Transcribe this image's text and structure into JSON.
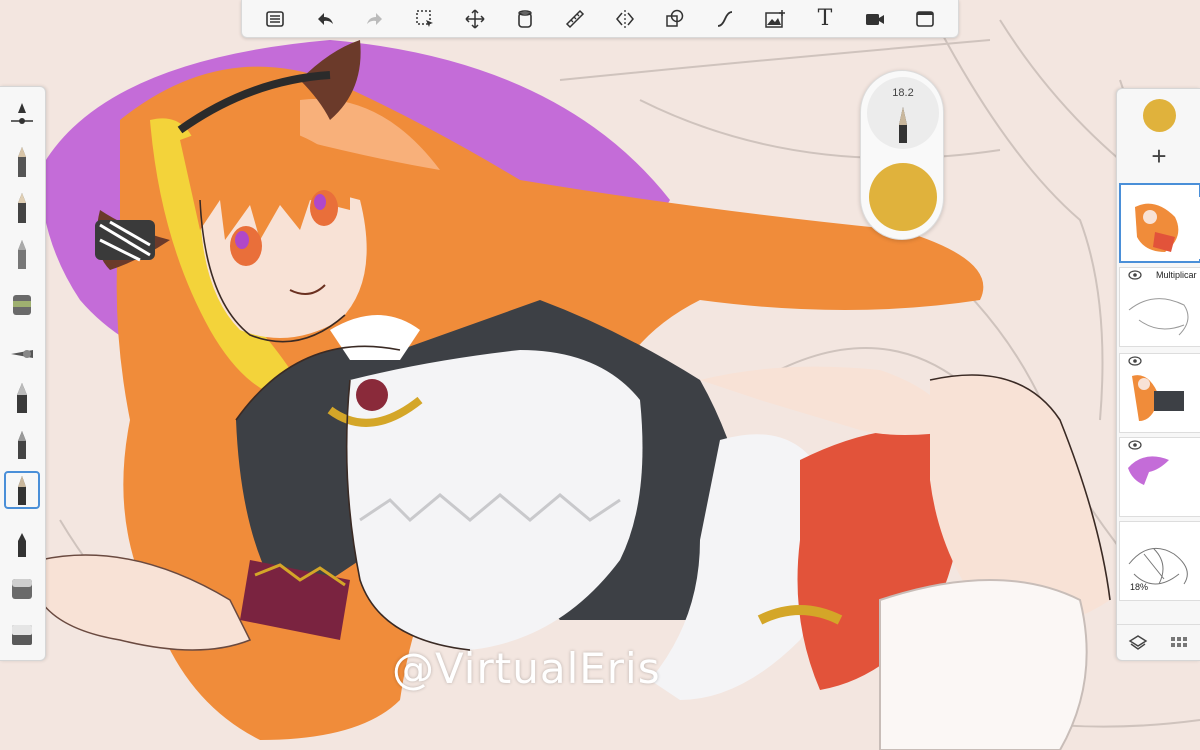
{
  "toolbar": {
    "tools": [
      {
        "name": "menu-icon"
      },
      {
        "name": "undo-icon"
      },
      {
        "name": "redo-icon"
      },
      {
        "name": "selection-icon"
      },
      {
        "name": "transform-icon"
      },
      {
        "name": "fill-bucket-icon"
      },
      {
        "name": "ruler-icon"
      },
      {
        "name": "symmetry-icon"
      },
      {
        "name": "shapes-icon"
      },
      {
        "name": "curve-icon"
      },
      {
        "name": "image-import-icon"
      },
      {
        "name": "text-tool",
        "label": "T"
      },
      {
        "name": "video-icon"
      },
      {
        "name": "fullscreen-icon"
      }
    ]
  },
  "puck": {
    "brush_size": "18.2",
    "color": "#e0b23c"
  },
  "layers": {
    "current_color": "#e0b23c",
    "add_symbol": "+",
    "items": [
      {
        "mode": "",
        "opacity": "",
        "active": true
      },
      {
        "mode": "Multiplicar",
        "opacity": "",
        "active": false
      },
      {
        "mode": "",
        "opacity": "",
        "active": false
      },
      {
        "mode": "",
        "opacity": "",
        "active": false
      },
      {
        "mode": "",
        "opacity": "18%",
        "active": false
      }
    ]
  },
  "watermark": "@VirtualEris",
  "colors": {
    "accent": "#4a8fd8",
    "hair": "#f08c3a",
    "pillow": "#c46cd8",
    "skirt": "#e2533a",
    "skin": "#f8e2d6",
    "background": "#f3e6e0"
  }
}
